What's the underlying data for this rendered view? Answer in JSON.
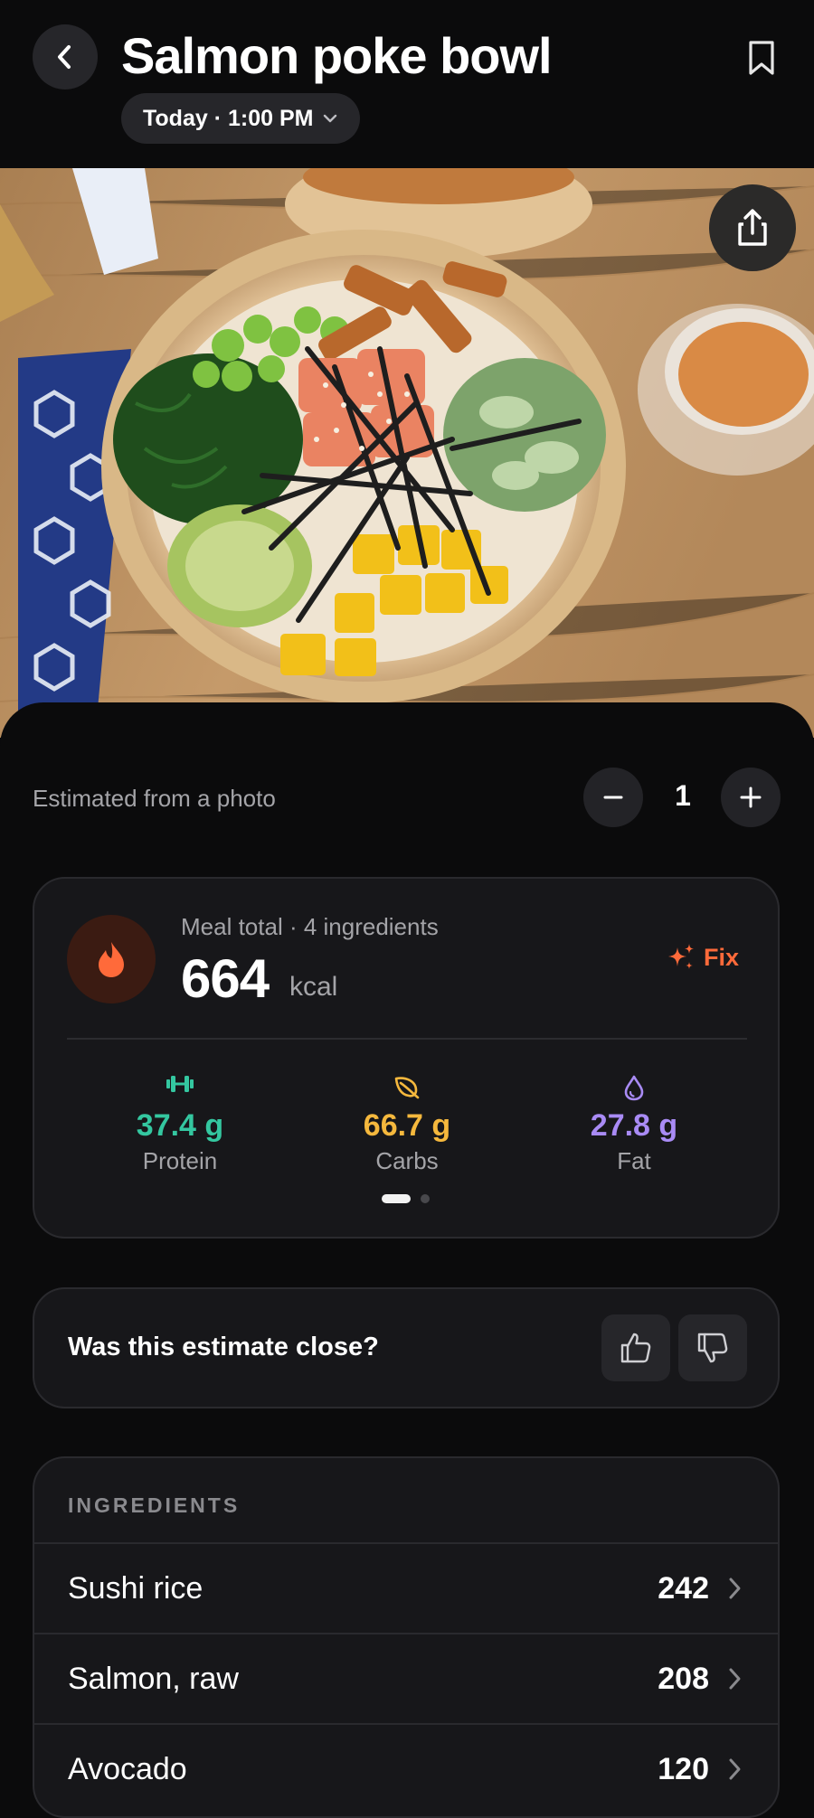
{
  "header": {
    "title": "Salmon poke bowl",
    "datetime": "Today · 1:00 PM"
  },
  "icons": {
    "back": "chevron-left-icon",
    "bookmark": "bookmark-icon",
    "share": "share-icon",
    "flame": "flame-icon",
    "fix": "sparkles-icon",
    "protein": "dumbbell-icon",
    "carbs": "leaf-icon",
    "fat": "droplet-icon",
    "thumbs_up": "thumbs-up-icon",
    "thumbs_down": "thumbs-down-icon"
  },
  "estimate": {
    "label": "Estimated from a photo",
    "servings": "1"
  },
  "summary": {
    "meal_total": "Meal total · 4 ingredients",
    "kcal": "664",
    "kcal_unit": "kcal",
    "fix_label": "Fix",
    "macros": [
      {
        "value": "37.4 g",
        "label": "Protein",
        "color": "#34c7a0"
      },
      {
        "value": "66.7 g",
        "label": "Carbs",
        "color": "#f5b83d"
      },
      {
        "value": "27.8 g",
        "label": "Fat",
        "color": "#a98bf5"
      }
    ],
    "page": 1,
    "pages": 2
  },
  "feedback": {
    "question": "Was this estimate close?"
  },
  "ingredients": {
    "header": "INGREDIENTS",
    "items": [
      {
        "name": "Sushi rice",
        "kcal": "242"
      },
      {
        "name": "Salmon, raw",
        "kcal": "208"
      },
      {
        "name": "Avocado",
        "kcal": "120"
      }
    ]
  },
  "colors": {
    "accent": "#ff6a3a",
    "background": "#0b0b0c",
    "card": "#17171a"
  }
}
